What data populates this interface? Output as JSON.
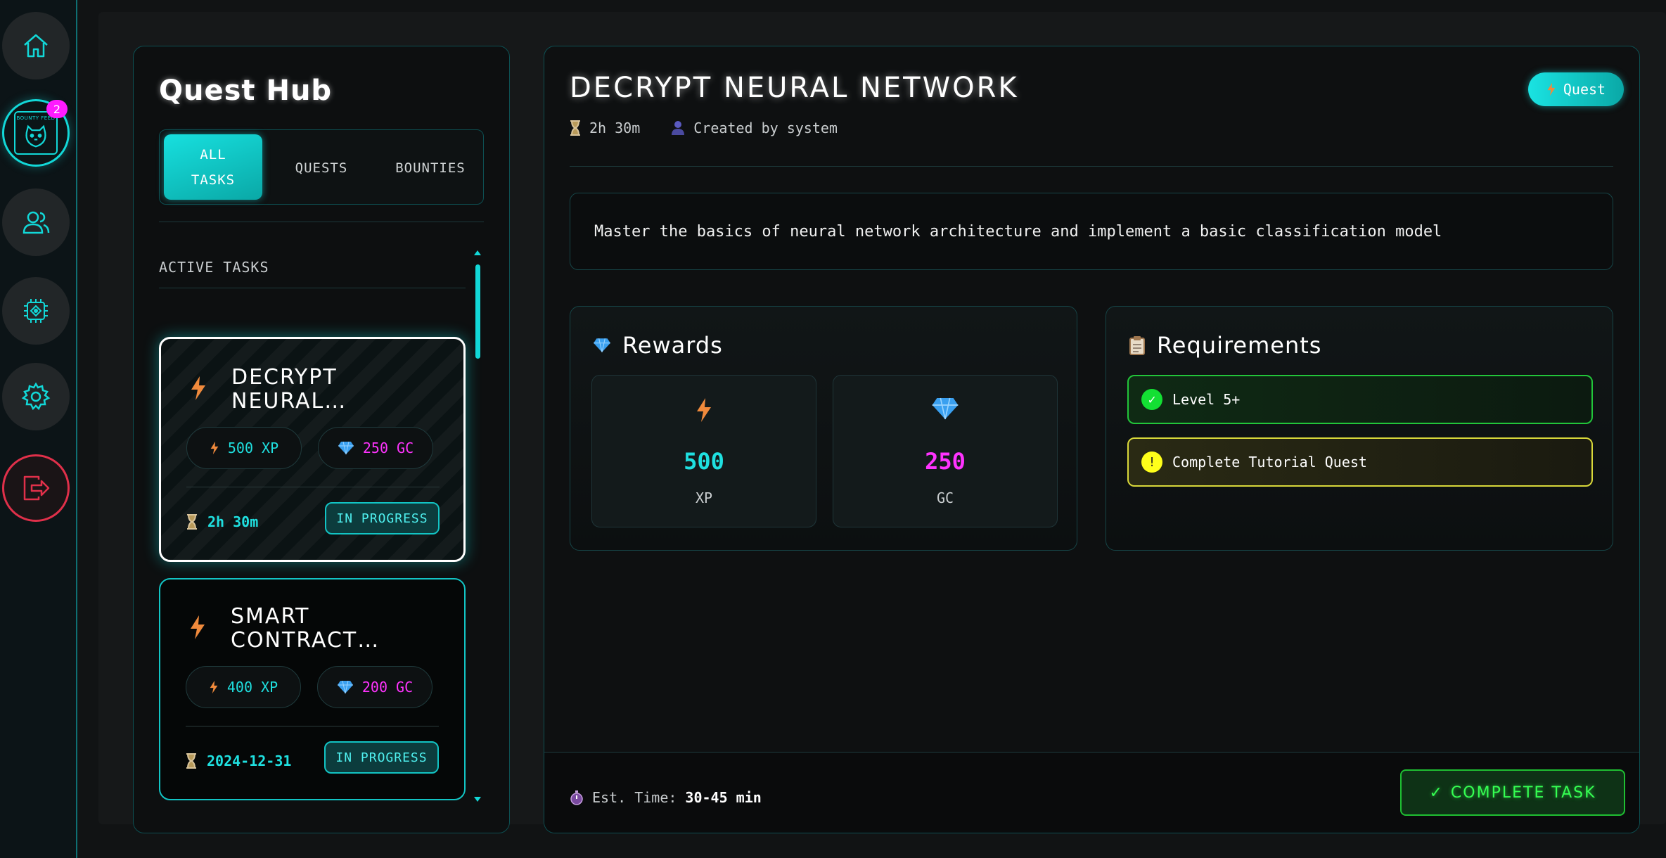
{
  "nav": {
    "items": [
      {
        "name": "home",
        "icon": "home-icon"
      },
      {
        "name": "bounty-feed",
        "icon": "bounty-feed-icon",
        "logo_text": "BOUNTY FEED",
        "badge": "2"
      },
      {
        "name": "users",
        "icon": "users-icon"
      },
      {
        "name": "chip",
        "icon": "chip-icon"
      },
      {
        "name": "settings",
        "icon": "gear-icon"
      },
      {
        "name": "logout",
        "icon": "logout-icon"
      }
    ]
  },
  "hub": {
    "title": "Quest Hub",
    "tabs": [
      "ALL TASKS",
      "QUESTS",
      "BOUNTIES"
    ],
    "active_tab": "ALL TASKS",
    "section_label": "ACTIVE TASKS",
    "tasks": [
      {
        "title": "DECRYPT NEURAL…",
        "xp": "500 XP",
        "gc": "250 GC",
        "time": "2h 30m",
        "status": "IN PROGRESS"
      },
      {
        "title": "SMART CONTRACT…",
        "xp": "400 XP",
        "gc": "200 GC",
        "time": "2024-12-31",
        "status": "IN PROGRESS"
      }
    ]
  },
  "detail": {
    "title": "DECRYPT NEURAL NETWORK",
    "type_label": "Quest",
    "duration": "2h 30m",
    "creator": "Created by system",
    "description": "Master the basics of neural network architecture and implement a basic classification model",
    "rewards_title": "Rewards",
    "rewards": [
      {
        "value": "500",
        "unit": "XP"
      },
      {
        "value": "250",
        "unit": "GC"
      }
    ],
    "requirements_title": "Requirements",
    "requirements": [
      {
        "label": "Level 5+",
        "state": "done"
      },
      {
        "label": "Complete Tutorial Quest",
        "state": "pending"
      }
    ],
    "est_label": "Est. Time:",
    "est_value": "30-45 min",
    "complete_label": "COMPLETE TASK"
  },
  "colors": {
    "accent": "#12d8d8",
    "xp": "#1fe0e0",
    "gc": "#ff33ff",
    "success": "#35ff52",
    "warning": "#ffff1a",
    "danger": "#e0304a"
  }
}
